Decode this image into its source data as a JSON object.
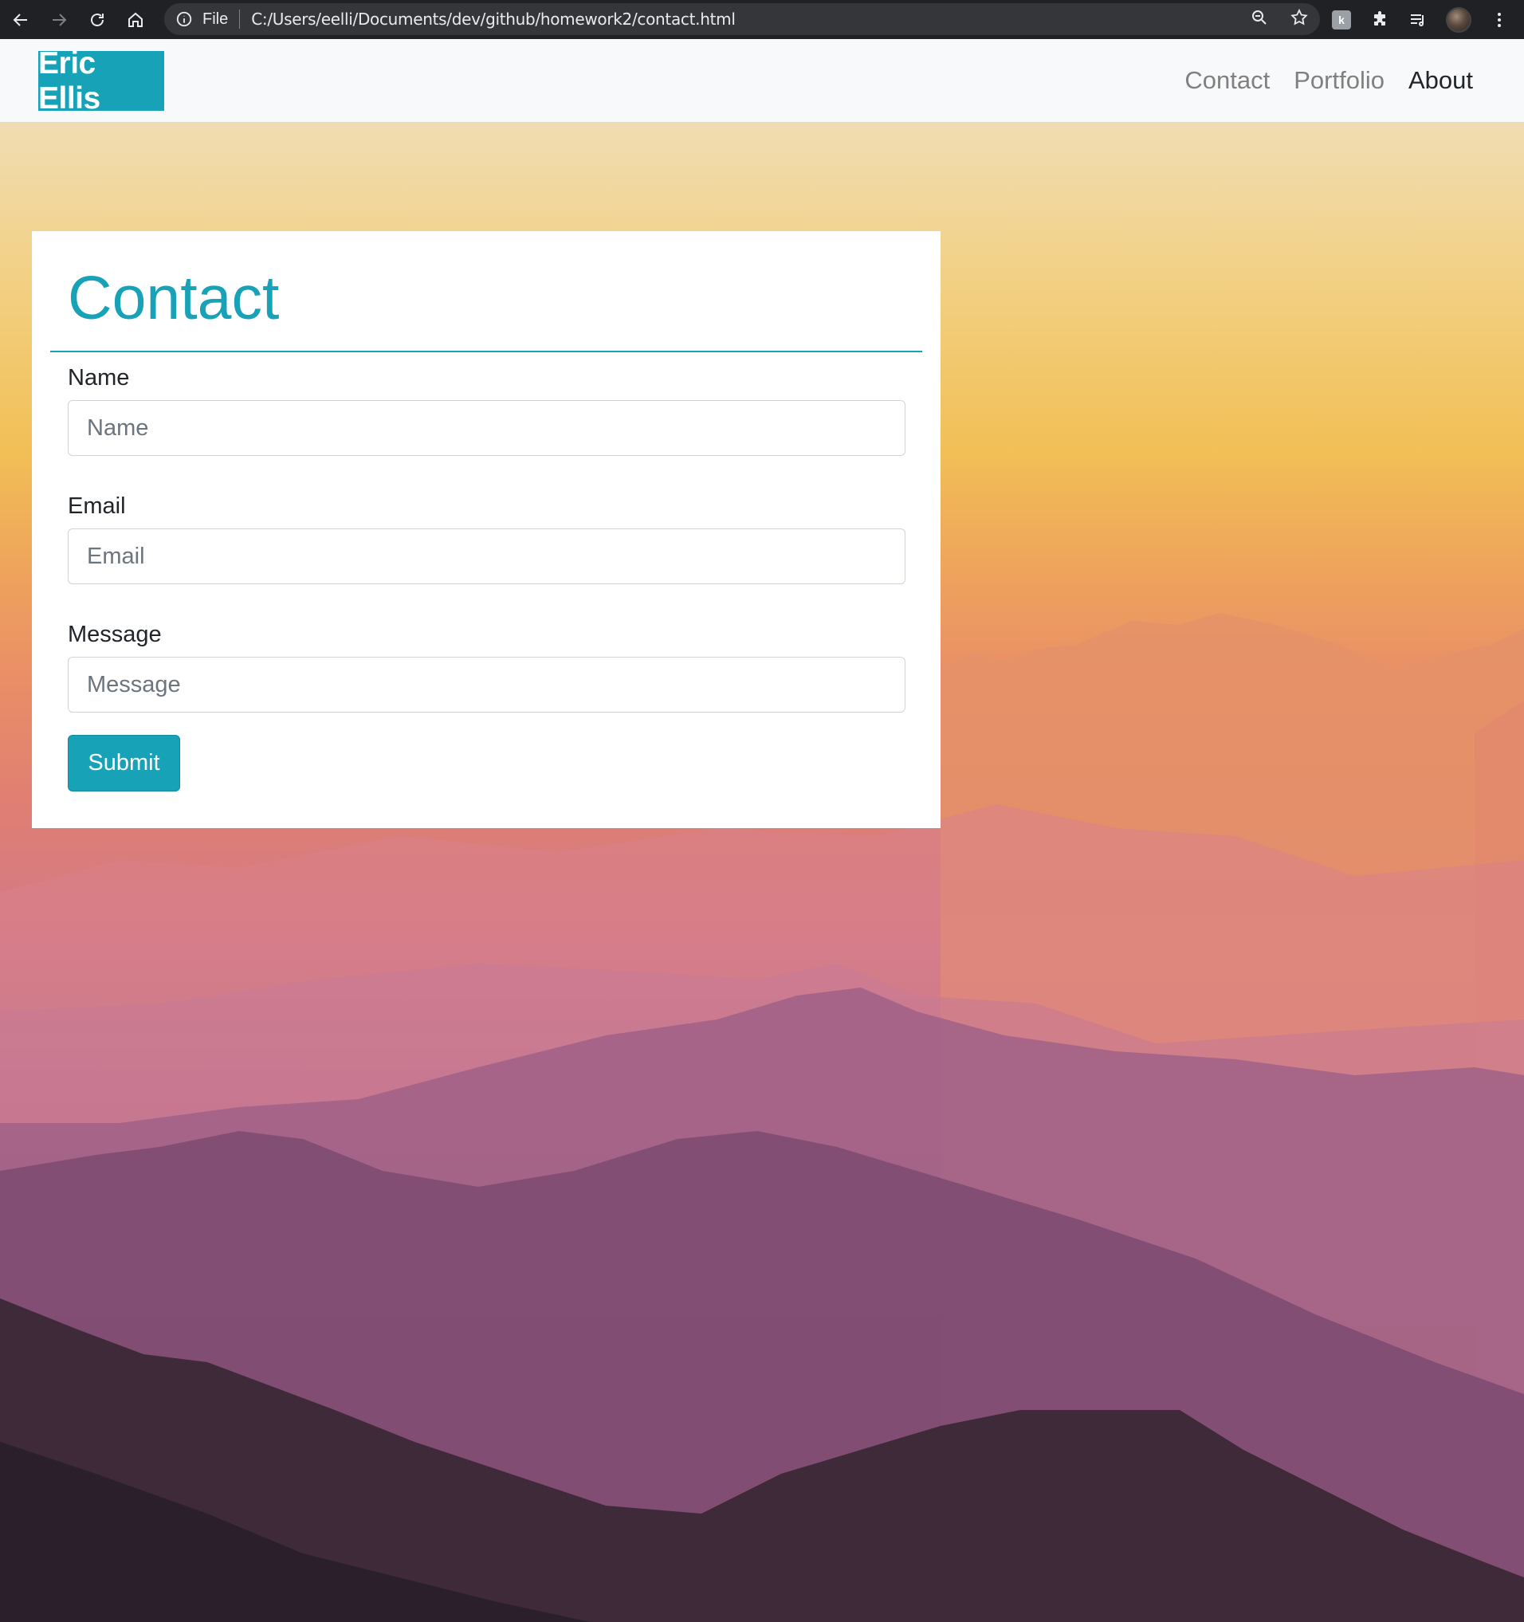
{
  "browser": {
    "scheme_label": "File",
    "url": "C:/Users/eelli/Documents/dev/github/homework2/contact.html",
    "icons": [
      "back-arrow-icon",
      "forward-arrow-icon",
      "reload-icon",
      "home-icon",
      "info-icon",
      "zoom-icon",
      "star-icon",
      "extension-icon",
      "puzzle-icon",
      "reading-list-icon",
      "profile-avatar",
      "menu-icon"
    ],
    "extension_letter": "k"
  },
  "site": {
    "brand": "Eric Ellis",
    "nav": [
      {
        "label": "Contact"
      },
      {
        "label": "Portfolio"
      },
      {
        "label": "About"
      }
    ],
    "accent_color": "#17a2b8"
  },
  "form": {
    "title": "Contact",
    "name_label": "Name",
    "name_placeholder": "Name",
    "email_label": "Email",
    "email_placeholder": "Email",
    "message_label": "Message",
    "message_placeholder": "Message",
    "submit_label": "Submit"
  }
}
